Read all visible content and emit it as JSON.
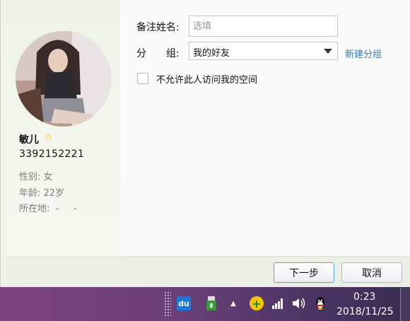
{
  "profile": {
    "name": "敏儿",
    "qq_number": "3392152221",
    "gender": "性别: 女",
    "age": "年龄: 22岁",
    "location": "所在地:  -     -"
  },
  "form": {
    "remark_label": "备注姓名:",
    "remark_placeholder": "选填",
    "group_label": "分　　组:",
    "group_value": "我的好友",
    "new_group_link": "新建分组",
    "checkbox_label": "不允许此人访问我的空间"
  },
  "buttons": {
    "next": "下一步",
    "cancel": "取消"
  },
  "taskbar": {
    "du_icon_text": "du",
    "time": "0:23",
    "date": "2018/11/25"
  },
  "colors": {
    "link": "#2a7dc4",
    "star": "#f0b400",
    "taskbar": "#6a3f78"
  }
}
